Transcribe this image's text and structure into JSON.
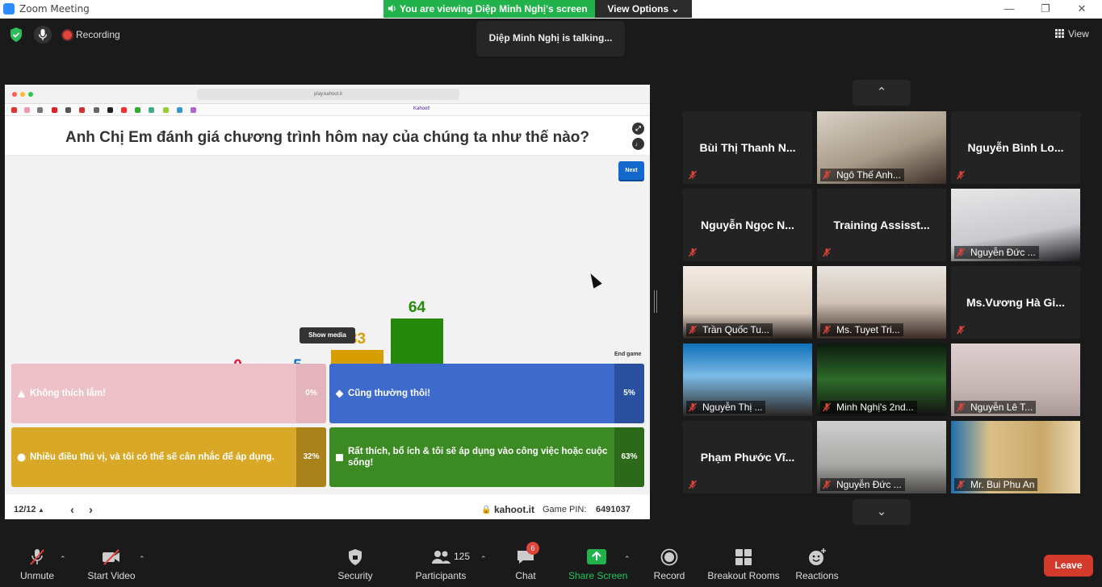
{
  "window": {
    "title": "Zoom Meeting"
  },
  "banner": {
    "viewing": "You are viewing Diệp Minh Nghị's screen",
    "view_options": "View Options"
  },
  "talking": "Diệp Minh Nghị is talking...",
  "topbar": {
    "recording": "Recording",
    "view": "View"
  },
  "browser": {
    "url": "play.kahoot.it",
    "bookmark_tab": "Kahoot!"
  },
  "kahoot": {
    "question": "Anh Chị Em đánh giá chương trình hôm nay của chúng ta như thế nào?",
    "next": "Next",
    "show_media": "Show media",
    "end_game": "End game",
    "page": "12/12",
    "site": "kahoot.it",
    "pin_label": "Game PIN:",
    "pin": "6491037",
    "answers": [
      {
        "text": "Không thích lắm!",
        "pct": "0%",
        "color": "#e21b3c",
        "shape": "triangle"
      },
      {
        "text": "Cũng thường thôi!",
        "pct": "5%",
        "color": "#1368ce",
        "shape": "diamond"
      },
      {
        "text": "Nhiều điều thú vị, và tôi có thể sẽ cân nhắc để áp dụng.",
        "pct": "32%",
        "color": "#d89e00",
        "shape": "circle"
      },
      {
        "text": "Rất thích, bổ ích & tôi sẽ áp dụng vào công việc hoặc cuộc sống!",
        "pct": "63%",
        "color": "#26890c",
        "shape": "square"
      }
    ]
  },
  "chart_data": {
    "type": "bar",
    "categories": [
      "Không thích lắm!",
      "Cũng thường thôi!",
      "Nhiều điều thú vị, và tôi có thể sẽ cân nhắc để áp dụng.",
      "Rất thích, bổ ích & tôi sẽ áp dụng vào công việc hoặc cuộc sống!"
    ],
    "values": [
      0,
      5,
      33,
      64
    ],
    "colors": [
      "#e21b3c",
      "#1368ce",
      "#d89e00",
      "#26890c"
    ],
    "ylim": [
      0,
      64
    ]
  },
  "gallery": [
    {
      "name": "Bùi Thị Thanh N...",
      "video": false
    },
    {
      "name": "Ngô Thế Anh...",
      "video": true
    },
    {
      "name": "Nguyễn Bình Lo...",
      "video": false
    },
    {
      "name": "Nguyễn Ngọc N...",
      "video": false
    },
    {
      "name": "Training Assisst...",
      "video": false
    },
    {
      "name": "Nguyễn Đức ...",
      "video": true
    },
    {
      "name": "Trần Quốc Tu...",
      "video": true
    },
    {
      "name": "Ms. Tuyet Tri...",
      "video": true
    },
    {
      "name": "Ms.Vương Hà Gi...",
      "video": false
    },
    {
      "name": "Nguyễn Thị ...",
      "video": true
    },
    {
      "name": "Minh Nghị's 2nd...",
      "video": true
    },
    {
      "name": "Nguyễn Lê T...",
      "video": true
    },
    {
      "name": "Phạm Phước Vĩ...",
      "video": false
    },
    {
      "name": "Nguyễn Đức ...",
      "video": true
    },
    {
      "name": "Mr. Bui Phu An",
      "video": true
    }
  ],
  "toolbar": {
    "unmute": "Unmute",
    "start_video": "Start Video",
    "security": "Security",
    "participants": "Participants",
    "participants_count": "125",
    "chat": "Chat",
    "chat_badge": "6",
    "share_screen": "Share Screen",
    "record": "Record",
    "breakout": "Breakout Rooms",
    "reactions": "Reactions",
    "leave": "Leave"
  }
}
